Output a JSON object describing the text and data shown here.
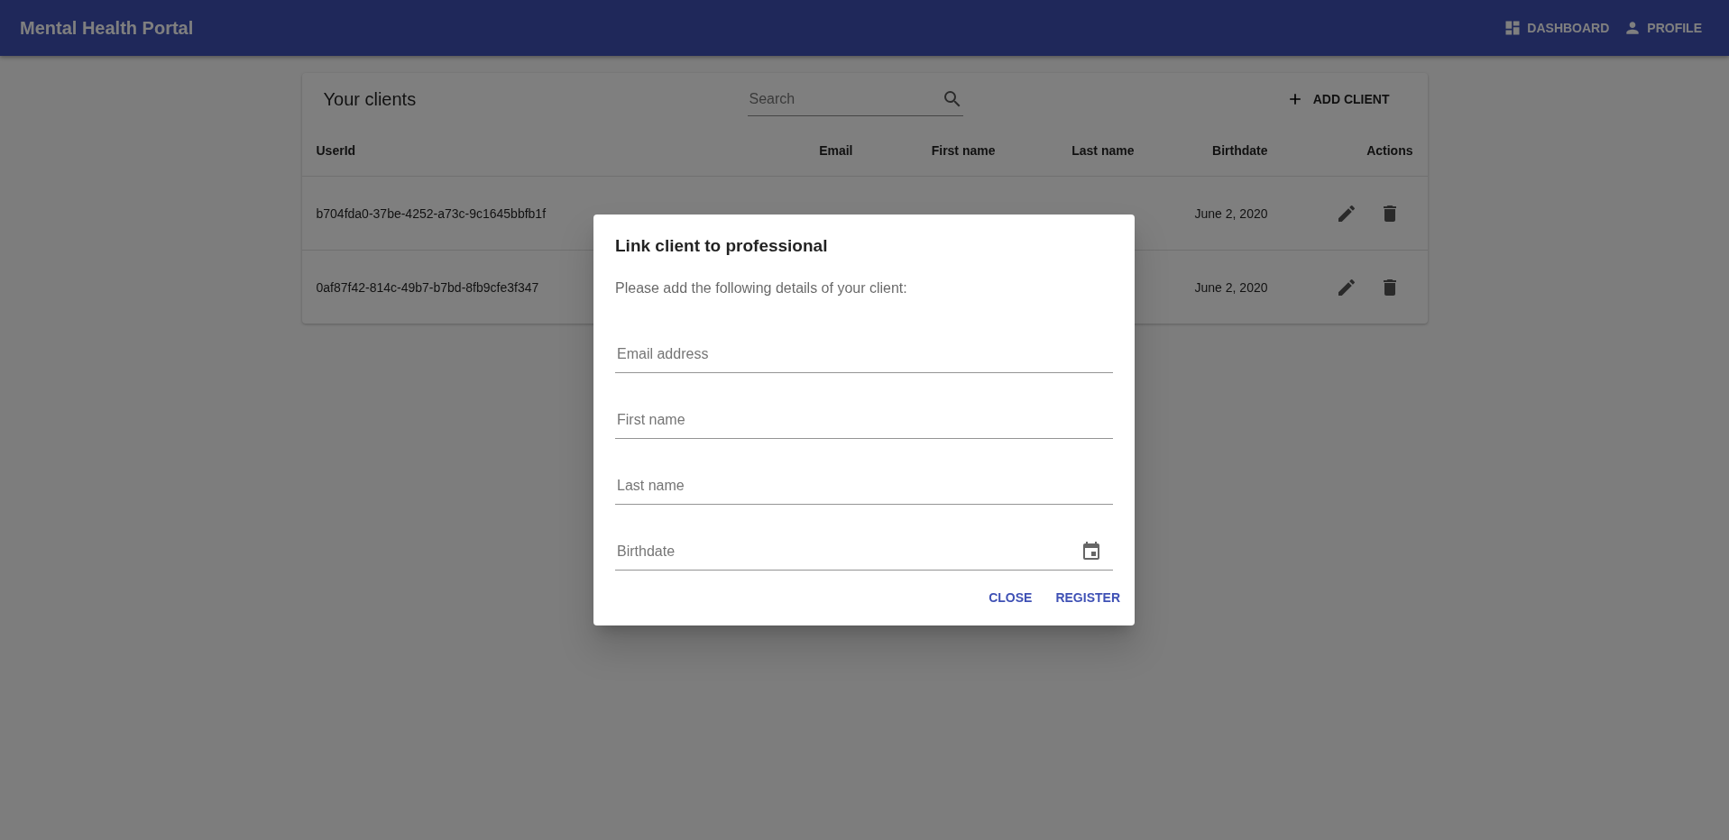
{
  "app_bar": {
    "title": "Mental Health Portal",
    "nav": [
      {
        "label": "DASHBOARD"
      },
      {
        "label": "PROFILE"
      }
    ]
  },
  "clients_card": {
    "title": "Your clients",
    "search": {
      "placeholder": "Search"
    },
    "add_button": "ADD CLIENT",
    "table": {
      "columns": [
        {
          "label": "UserId"
        },
        {
          "label": "Email"
        },
        {
          "label": "First name"
        },
        {
          "label": "Last name"
        },
        {
          "label": "Birthdate"
        },
        {
          "label": "Actions"
        }
      ],
      "rows": [
        {
          "userid": "b704fda0-37be-4252-a73c-9c1645bbfb1f",
          "birthdate": "June 2, 2020"
        },
        {
          "userid": "0af87f42-814c-49b7-b7bd-8fb9cfe3f347",
          "birthdate": "June 2, 2020"
        }
      ]
    }
  },
  "dialog": {
    "title": "Link client to professional",
    "text": "Please add the following details of your client:",
    "fields": [
      {
        "placeholder": "Email address",
        "kind": "text"
      },
      {
        "placeholder": "First name",
        "kind": "text"
      },
      {
        "placeholder": "Last name",
        "kind": "text"
      },
      {
        "placeholder": "Birthdate",
        "kind": "date"
      }
    ],
    "buttons": [
      "CLOSE",
      "REGISTER"
    ]
  }
}
